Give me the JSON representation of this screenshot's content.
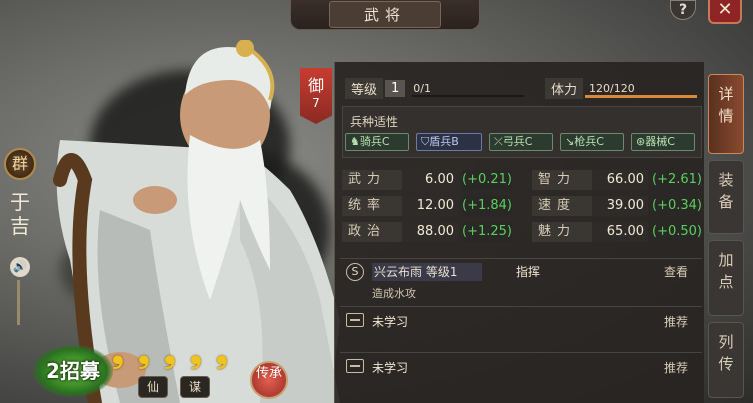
{
  "title": "武将",
  "help_label": "?",
  "close_label": "✕",
  "general": {
    "faction": "群",
    "name": "于吉",
    "recruit_label": "招募",
    "recruit_prefix": "2",
    "tags": [
      "仙",
      "谋"
    ],
    "inherit_label": "传承",
    "stars": 5
  },
  "rank": {
    "label": "御",
    "value": "7"
  },
  "level": {
    "label": "等级",
    "value": "1",
    "exp": "0/1"
  },
  "stamina": {
    "label": "体力",
    "value": "120/120",
    "fraction": 1.0
  },
  "affinity": {
    "title": "兵种适性",
    "items": [
      {
        "label": "骑兵C",
        "icon": "horse-icon",
        "kind": "g"
      },
      {
        "label": "盾兵B",
        "icon": "shield-icon",
        "kind": "b"
      },
      {
        "label": "弓兵C",
        "icon": "bow-icon",
        "kind": "g"
      },
      {
        "label": "枪兵C",
        "icon": "spear-icon",
        "kind": "g"
      },
      {
        "label": "器械C",
        "icon": "gear-icon",
        "kind": "g"
      }
    ]
  },
  "stats": [
    {
      "name": "武力",
      "value": "6.00",
      "delta": "(+0.21)"
    },
    {
      "name": "智力",
      "value": "66.00",
      "delta": "(+2.61)"
    },
    {
      "name": "统率",
      "value": "12.00",
      "delta": "(+1.84)"
    },
    {
      "name": "速度",
      "value": "39.00",
      "delta": "(+0.34)"
    },
    {
      "name": "政治",
      "value": "88.00",
      "delta": "(+1.25)"
    },
    {
      "name": "魅力",
      "value": "65.00",
      "delta": "(+0.50)"
    }
  ],
  "skills": [
    {
      "badge": "S",
      "name": "兴云布雨 等级1",
      "type": "指挥",
      "action": "查看",
      "desc": "造成水攻"
    },
    {
      "name": "未学习",
      "action": "推荐"
    },
    {
      "name": "未学习",
      "action": "推荐"
    }
  ],
  "tabs": [
    {
      "label": "详情",
      "active": true
    },
    {
      "label": "装备",
      "active": false
    },
    {
      "label": "加点",
      "active": false
    },
    {
      "label": "列传",
      "active": false
    }
  ]
}
